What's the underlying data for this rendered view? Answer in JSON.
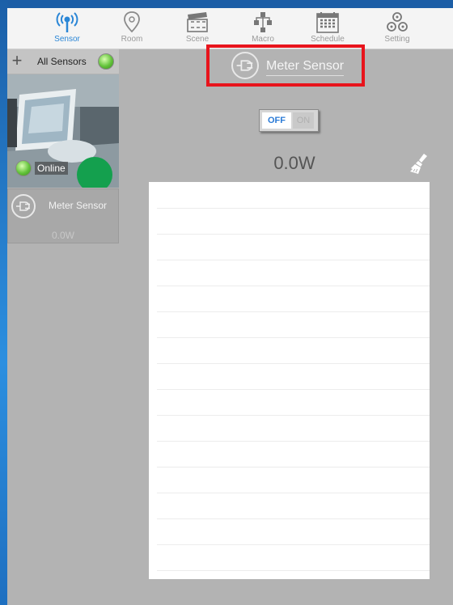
{
  "tabs": [
    {
      "label": "Sensor",
      "icon": "radio-antenna-icon",
      "active": true
    },
    {
      "label": "Room",
      "icon": "map-pin-icon",
      "active": false
    },
    {
      "label": "Scene",
      "icon": "clapperboard-icon",
      "active": false
    },
    {
      "label": "Macro",
      "icon": "flowchart-icon",
      "active": false
    },
    {
      "label": "Schedule",
      "icon": "calendar-icon",
      "active": false
    },
    {
      "label": "Setting",
      "icon": "gears-icon",
      "active": false
    }
  ],
  "sidebar": {
    "all_sensors_label": "All Sensors",
    "camera_status": "Online",
    "sensor_item": {
      "name": "Meter Sensor",
      "power": "0.0W"
    }
  },
  "main": {
    "title": "Meter Sensor",
    "toggle": {
      "off_label": "OFF",
      "on_label": "ON",
      "state": "off"
    },
    "power": "0.0W"
  },
  "colors": {
    "accent": "#2a86d6",
    "highlight": "#e8141c",
    "status_green": "#62c23a"
  }
}
